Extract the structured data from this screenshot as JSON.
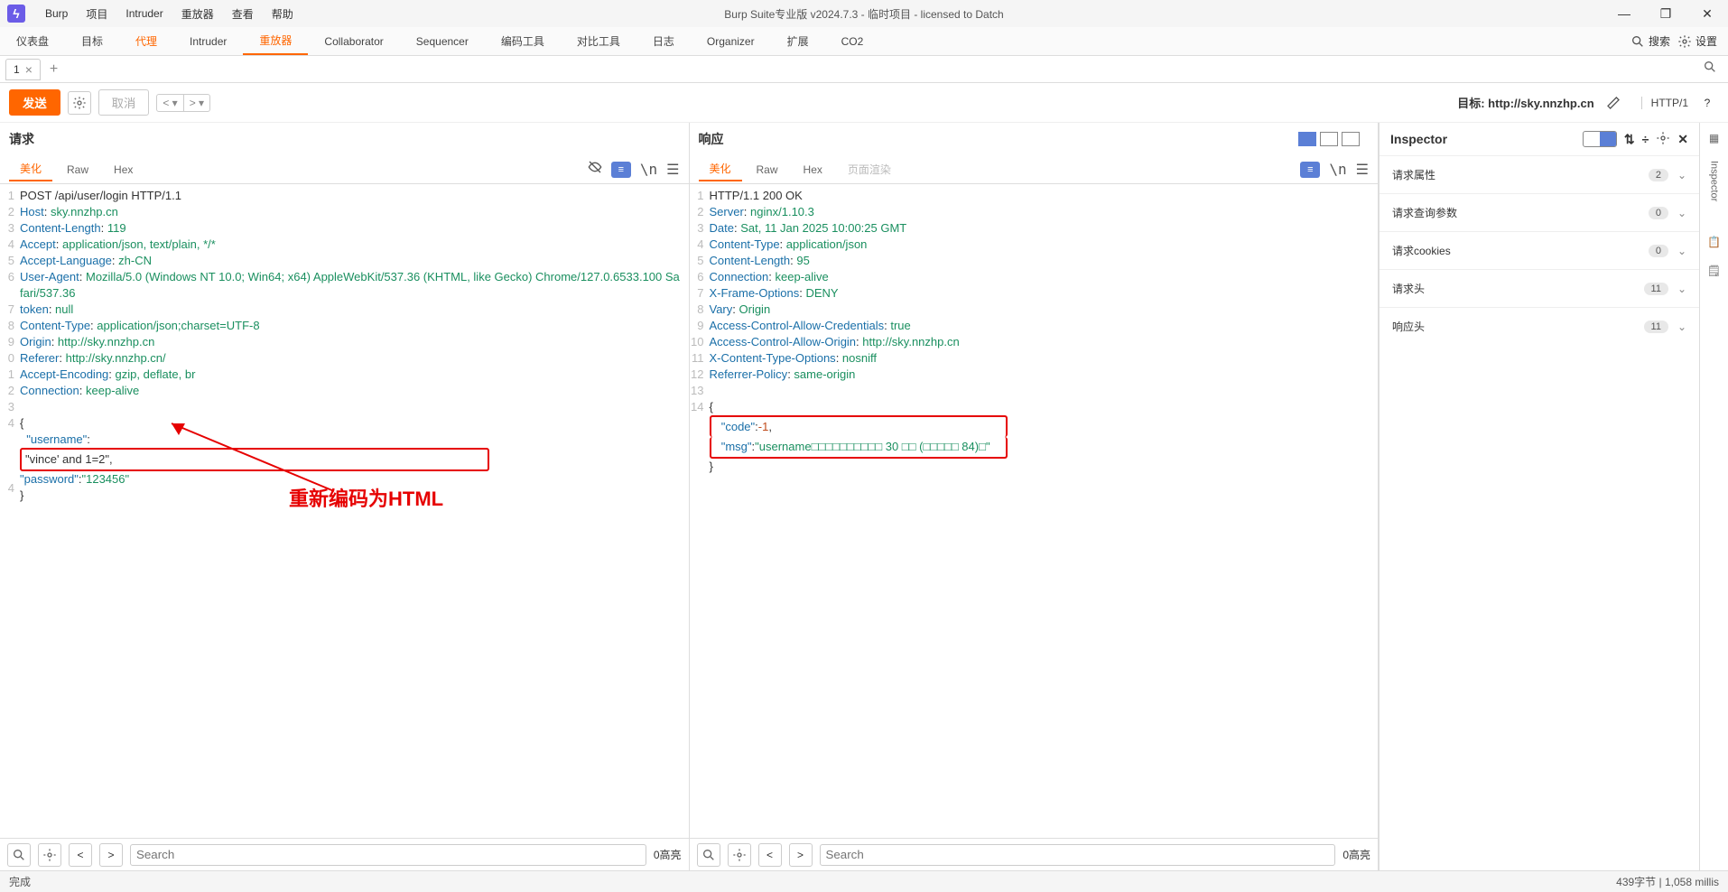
{
  "window": {
    "title": "Burp Suite专业版  v2024.7.3 - 临时项目 - licensed to Datch",
    "menus": [
      "Burp",
      "项目",
      "Intruder",
      "重放器",
      "查看",
      "帮助"
    ]
  },
  "topTabs": [
    "仪表盘",
    "目标",
    "代理",
    "Intruder",
    "重放器",
    "Collaborator",
    "Sequencer",
    "编码工具",
    "对比工具",
    "日志",
    "Organizer",
    "扩展",
    "CO2"
  ],
  "topTabActive": "重放器",
  "searchLabel": "搜索",
  "settingsLabel": "设置",
  "subtab": {
    "label": "1"
  },
  "toolbar": {
    "send": "发送",
    "cancel": "取消",
    "targetPrefix": "目标: ",
    "targetUrl": "http://sky.nnzhp.cn",
    "http": "HTTP/1"
  },
  "request": {
    "title": "请求",
    "tabs": [
      "美化",
      "Raw",
      "Hex"
    ],
    "active": "美化",
    "lines": [
      "POST /api/user/login HTTP/1.1",
      "Host: sky.nnzhp.cn",
      "Content-Length: 119",
      "Accept: application/json, text/plain, */*",
      "Accept-Language: zh-CN",
      "User-Agent: Mozilla/5.0 (Windows NT 10.0; Win64; x64) AppleWebKit/537.36 (KHTML, like Gecko) Chrome/127.0.6533.100 Safari/537.36",
      "token: null",
      "Content-Type: application/json;charset=UTF-8",
      "Origin: http://sky.nnzhp.cn",
      "Referer: http://sky.nnzhp.cn/",
      "Accept-Encoding: gzip, deflate, br",
      "Connection: keep-alive",
      "",
      "{",
      "  \"username\":",
      "\"&#x76;&#x69;&#x6e;&#x63;&#x65;&#x27;&#x20;&#x61;&#x6e;&#x64;&#x20;&#x31;&#x3d;&#x32;\",",
      "\"password\":\"123456\"",
      "}"
    ],
    "gutters": [
      "1",
      "2",
      "3",
      "4",
      "5",
      "6",
      "",
      "7",
      "8",
      "9",
      "0",
      "1",
      "2",
      "3",
      "4",
      "",
      "",
      "",
      "4"
    ],
    "annotation": "重新编码为HTML"
  },
  "response": {
    "title": "响应",
    "tabs": [
      "美化",
      "Raw",
      "Hex",
      "页面渲染"
    ],
    "active": "美化",
    "lines": [
      "HTTP/1.1 200 OK",
      "Server: nginx/1.10.3",
      "Date: Sat, 11 Jan 2025 10:00:25 GMT",
      "Content-Type: application/json",
      "Content-Length: 95",
      "Connection: keep-alive",
      "X-Frame-Options: DENY",
      "Vary: Origin",
      "Access-Control-Allow-Credentials: true",
      "Access-Control-Allow-Origin: http://sky.nnzhp.cn",
      "X-Content-Type-Options: nosniff",
      "Referrer-Policy: same-origin",
      "",
      "{",
      "  \"code\":-1,",
      "  \"msg\":\"username□□□□□□□□□□ 30 □□ (□□□□□ 84)□\"",
      "}"
    ],
    "gutters": [
      "1",
      "2",
      "3",
      "4",
      "5",
      "6",
      "7",
      "8",
      "9",
      "10",
      "11",
      "12",
      "13",
      "14",
      "",
      "",
      ""
    ]
  },
  "paneFoot": {
    "searchPlaceholder": "Search",
    "hits": "0高亮"
  },
  "inspector": {
    "title": "Inspector",
    "rows": [
      {
        "label": "请求属性",
        "count": "2"
      },
      {
        "label": "请求查询参数",
        "count": "0"
      },
      {
        "label": "请求cookies",
        "count": "0"
      },
      {
        "label": "请求头",
        "count": "11"
      },
      {
        "label": "响应头",
        "count": "11"
      }
    ]
  },
  "rside": {
    "label": "Inspector"
  },
  "status": {
    "left": "完成",
    "right": "439字节 | 1,058 millis"
  }
}
